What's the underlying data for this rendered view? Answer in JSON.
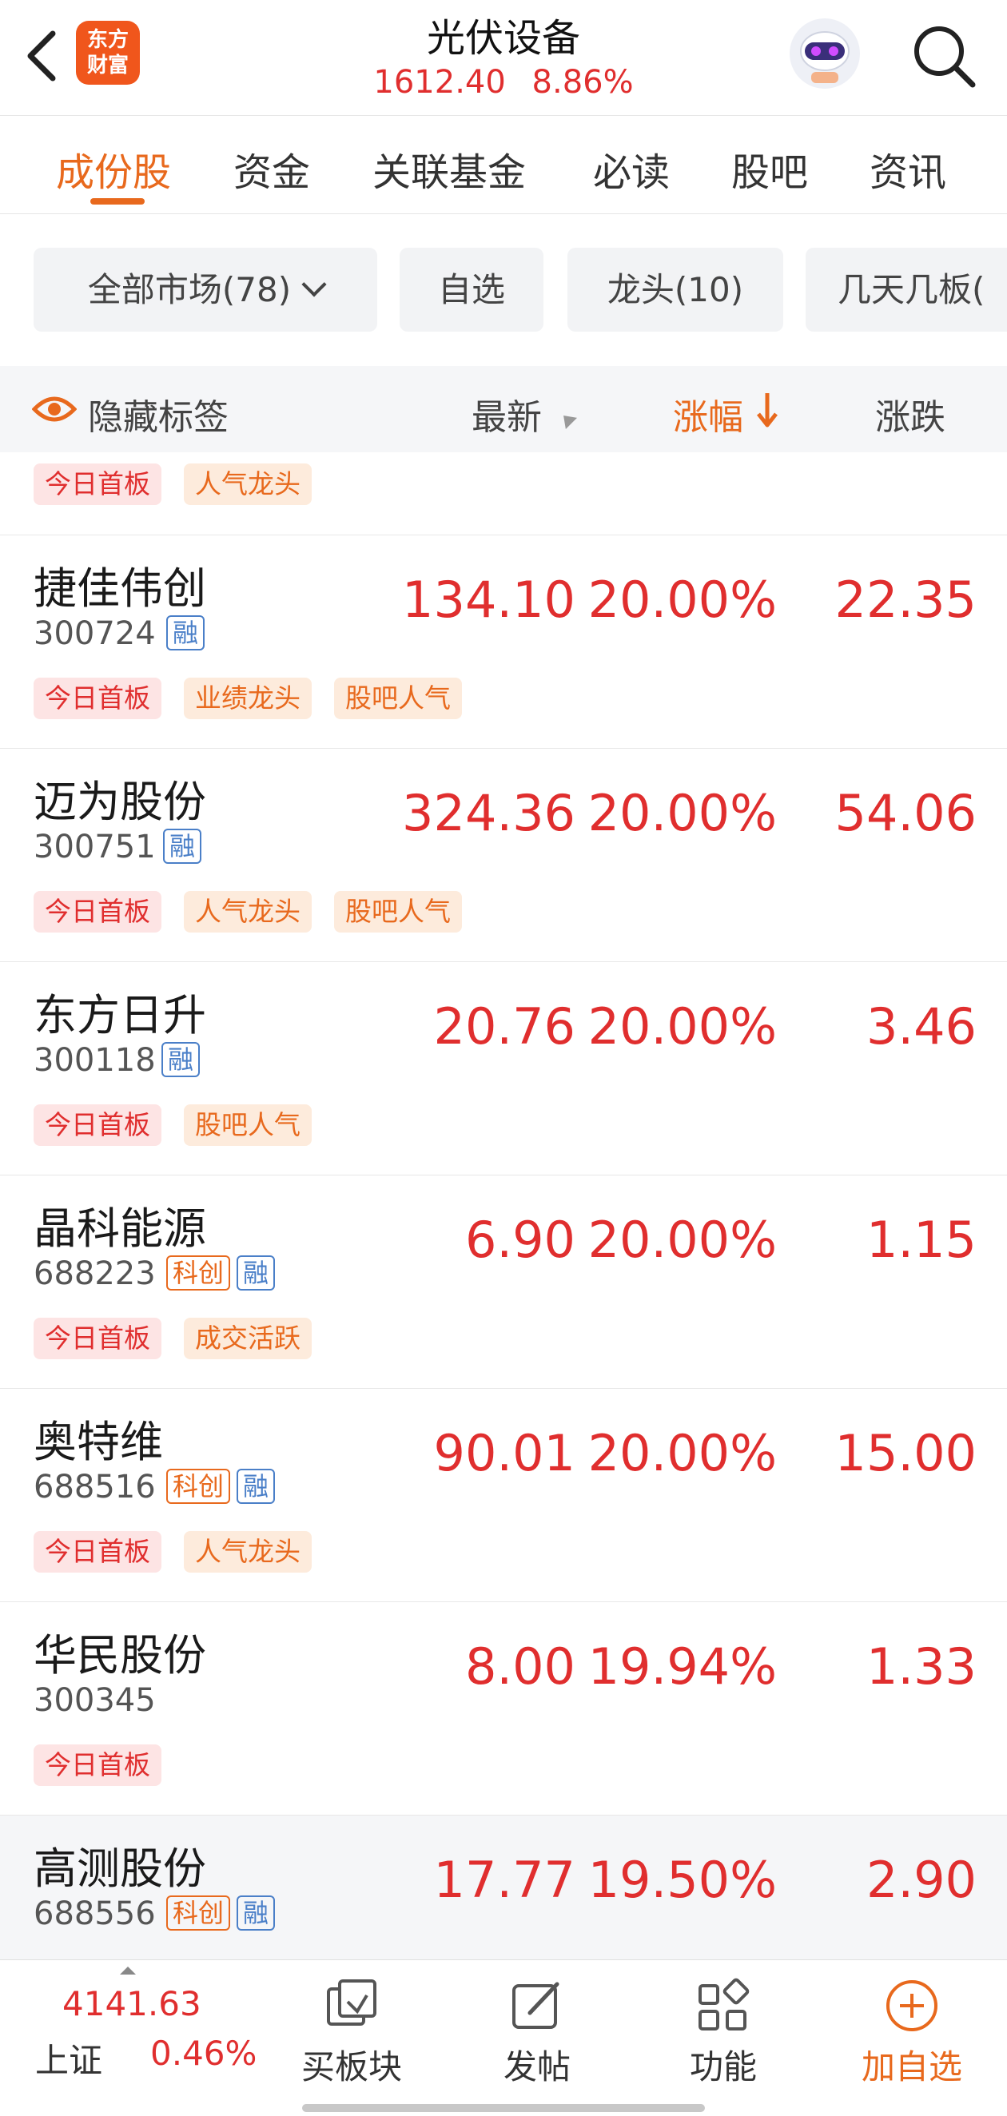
{
  "header": {
    "title": "光伏设备",
    "index_value": "1612.40",
    "index_pct": "8.86%",
    "logo_line1": "东方",
    "logo_line2": "财富"
  },
  "tabs": [
    "成份股",
    "资金",
    "关联基金",
    "必读",
    "股吧",
    "资讯"
  ],
  "filters": [
    "全部市场(78)",
    "自选",
    "龙头(10)",
    "几天几板("
  ],
  "columns": {
    "hide_tags": "隐藏标签",
    "latest": "最新",
    "pct": "涨幅",
    "change": "涨跌"
  },
  "partial_row": {
    "tags": [
      "今日首板",
      "人气龙头"
    ]
  },
  "stocks": [
    {
      "name": "捷佳伟创",
      "code": "300724",
      "kechuang": "",
      "rong": "融",
      "price": "134.10",
      "pct": "20.00%",
      "change": "22.35",
      "tags": [
        "今日首板",
        "业绩龙头",
        "股吧人气"
      ]
    },
    {
      "name": "迈为股份",
      "code": "300751",
      "kechuang": "",
      "rong": "融",
      "price": "324.36",
      "pct": "20.00%",
      "change": "54.06",
      "tags": [
        "今日首板",
        "人气龙头",
        "股吧人气"
      ]
    },
    {
      "name": "东方日升",
      "code": "300118",
      "kechuang": "",
      "rong": "融",
      "price": "20.76",
      "pct": "20.00%",
      "change": "3.46",
      "tags": [
        "今日首板",
        "股吧人气"
      ]
    },
    {
      "name": "晶科能源",
      "code": "688223",
      "kechuang": "科创",
      "rong": "融",
      "price": "6.90",
      "pct": "20.00%",
      "change": "1.15",
      "tags": [
        "今日首板",
        "成交活跃"
      ]
    },
    {
      "name": "奥特维",
      "code": "688516",
      "kechuang": "科创",
      "rong": "融",
      "price": "90.01",
      "pct": "20.00%",
      "change": "15.00",
      "tags": [
        "今日首板",
        "人气龙头"
      ]
    },
    {
      "name": "华民股份",
      "code": "300345",
      "kechuang": "",
      "rong": "",
      "price": "8.00",
      "pct": "19.94%",
      "change": "1.33",
      "tags": [
        "今日首板"
      ]
    },
    {
      "name": "高测股份",
      "code": "688556",
      "kechuang": "科创",
      "rong": "融",
      "price": "17.77",
      "pct": "19.50%",
      "change": "2.90",
      "tags": []
    }
  ],
  "bottom": {
    "index_value": "4141.63",
    "index_name": "上证",
    "index_pct": "0.46%",
    "nav": [
      "买板块",
      "发帖",
      "功能",
      "加自选"
    ]
  },
  "colors": {
    "accent": "#e8691d",
    "up": "#e02e2e",
    "rong_badge": "#4a7fc8"
  }
}
